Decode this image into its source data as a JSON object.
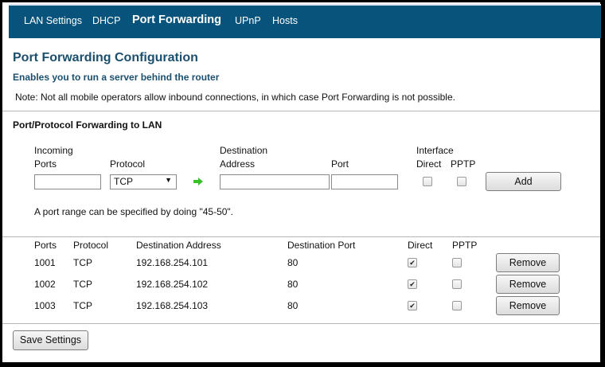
{
  "nav": {
    "items": [
      "LAN Settings",
      "DHCP",
      "Port Forwarding",
      "UPnP",
      "Hosts"
    ],
    "active": "Port Forwarding"
  },
  "page": {
    "title": "Port Forwarding Configuration",
    "subtitle": "Enables you to run a server behind the router",
    "note": "Note: Not all mobile operators allow inbound connections, in which case Port Forwarding is not possible."
  },
  "form": {
    "section_title": "Port/Protocol Forwarding to LAN",
    "incoming_label": "Incoming",
    "ports_label": "Ports",
    "protocol_label": "Protocol",
    "destination_label": "Destination",
    "address_label": "Address",
    "port_label": "Port",
    "interface_label": "Interface",
    "direct_label": "Direct",
    "pptp_label": "PPTP",
    "protocol_value": "TCP",
    "incoming_ports_value": "",
    "dest_address_value": "",
    "dest_port_value": "",
    "direct_checked": false,
    "pptp_checked": false,
    "add_label": "Add",
    "hint": "A port range can be specified by doing \"45-50\"."
  },
  "table": {
    "headers": [
      "Ports",
      "Protocol",
      "Destination Address",
      "Destination Port",
      "Direct",
      "PPTP"
    ],
    "rows": [
      {
        "ports": "1001",
        "protocol": "TCP",
        "address": "192.168.254.101",
        "dest_port": "80",
        "direct": true,
        "pptp": false,
        "remove_label": "Remove"
      },
      {
        "ports": "1002",
        "protocol": "TCP",
        "address": "192.168.254.102",
        "dest_port": "80",
        "direct": true,
        "pptp": false,
        "remove_label": "Remove"
      },
      {
        "ports": "1003",
        "protocol": "TCP",
        "address": "192.168.254.103",
        "dest_port": "80",
        "direct": true,
        "pptp": false,
        "remove_label": "Remove"
      }
    ]
  },
  "save_label": "Save Settings",
  "colors": {
    "nav_bg": "#07537c",
    "title": "#1b4f6e",
    "arrow": "#3bbf2a"
  }
}
